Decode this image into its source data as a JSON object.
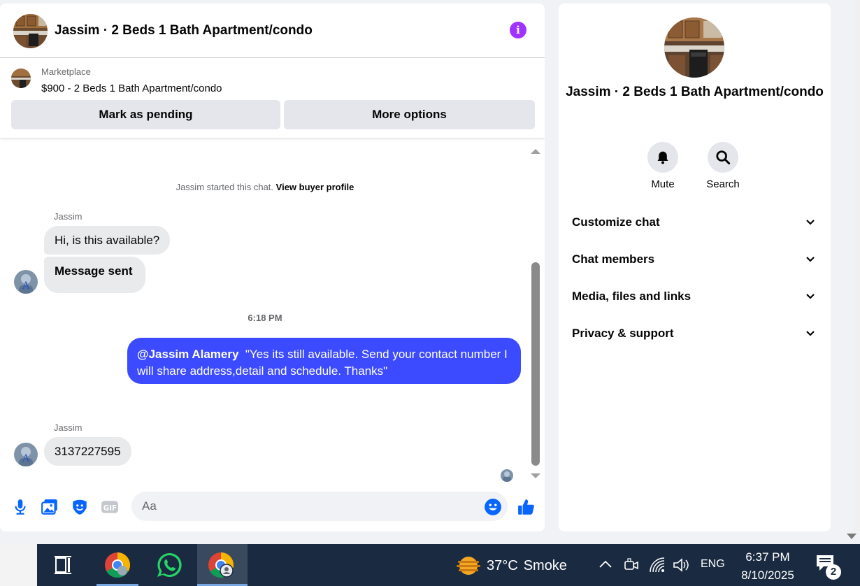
{
  "chat": {
    "title": "Jassim · 2 Beds 1 Bath Apartment/condo",
    "info_icon": "info-icon",
    "marketplace": {
      "label": "Marketplace",
      "listing": "$900 - 2 Beds 1 Bath Apartment/condo",
      "mark_pending_label": "Mark as pending",
      "more_options_label": "More options"
    },
    "system_text": "Jassim started this chat.",
    "system_link": "View buyer profile",
    "sender_name": "Jassim",
    "messages_in_1": [
      "Hi, is this available?",
      "Message sent"
    ],
    "timestamp": "6:18 PM",
    "outgoing": {
      "mention": "@Jassim Alamery",
      "text": "\"Yes its still available. Send your contact number I will share address,detail and schedule. Thanks\""
    },
    "sender_name_2": "Jassim",
    "messages_in_2": [
      "3137227595"
    ],
    "composer": {
      "placeholder": "Aa",
      "icons": [
        "microphone-icon",
        "photo-icon",
        "sticker-icon",
        "gif-icon",
        "emoji-icon",
        "thumbs-up-icon"
      ],
      "gif_label": "GIF"
    },
    "accent_color": "#3c4bff"
  },
  "sidebar": {
    "title": "Jassim · 2 Beds 1 Bath Apartment/condo",
    "actions": [
      {
        "label": "Mute",
        "icon": "bell-icon"
      },
      {
        "label": "Search",
        "icon": "search-icon"
      }
    ],
    "sections": [
      "Customize chat",
      "Chat members",
      "Media, files and links",
      "Privacy & support"
    ]
  },
  "taskbar": {
    "apps": [
      "task-view-icon",
      "chrome-icon",
      "whatsapp-icon",
      "chrome-profile-icon"
    ],
    "weather": {
      "temp": "37°C",
      "condition": "Smoke"
    },
    "language": "ENG",
    "time": "6:37 PM",
    "date": "8/10/2025",
    "notification_count": "2"
  }
}
